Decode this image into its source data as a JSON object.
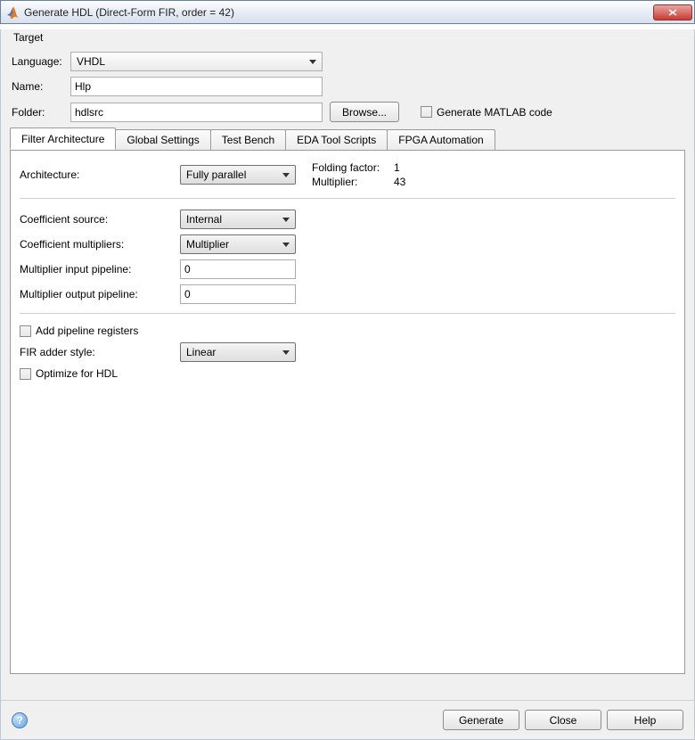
{
  "window": {
    "title": "Generate HDL (Direct-Form FIR, order = 42)"
  },
  "target": {
    "legend": "Target",
    "language_label": "Language:",
    "language_value": "VHDL",
    "name_label": "Name:",
    "name_value": "Hlp",
    "folder_label": "Folder:",
    "folder_value": "hdlsrc",
    "browse_label": "Browse...",
    "generate_matlab_label": "Generate MATLAB code"
  },
  "tabs": [
    "Filter Architecture",
    "Global Settings",
    "Test Bench",
    "EDA Tool Scripts",
    "FPGA Automation"
  ],
  "arch": {
    "architecture_label": "Architecture:",
    "architecture_value": "Fully parallel",
    "folding_label": "Folding factor:",
    "folding_value": "1",
    "mult_label": "Multiplier:",
    "mult_value": "43",
    "coeff_src_label": "Coefficient source:",
    "coeff_src_value": "Internal",
    "coeff_mult_label": "Coefficient multipliers:",
    "coeff_mult_value": "Multiplier",
    "mult_in_pipe_label": "Multiplier input pipeline:",
    "mult_in_pipe_value": "0",
    "mult_out_pipe_label": "Multiplier output pipeline:",
    "mult_out_pipe_value": "0",
    "add_pipe_label": "Add pipeline registers",
    "fir_adder_label": "FIR adder style:",
    "fir_adder_value": "Linear",
    "optimize_label": "Optimize for HDL"
  },
  "buttons": {
    "generate": "Generate",
    "close": "Close",
    "help": "Help"
  }
}
